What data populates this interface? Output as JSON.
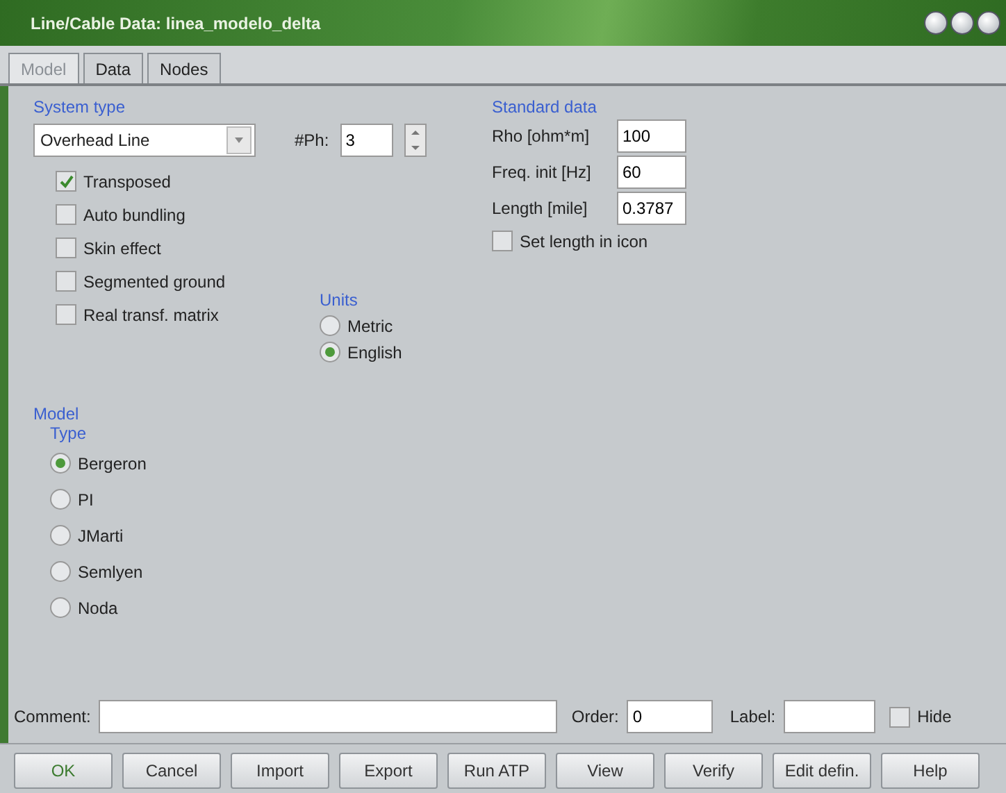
{
  "window": {
    "title": "Line/Cable Data: linea_modelo_delta"
  },
  "tabs": [
    {
      "label": "Model",
      "selected": true
    },
    {
      "label": "Data",
      "selected": false
    },
    {
      "label": "Nodes",
      "selected": false
    }
  ],
  "system_type": {
    "heading": "System type",
    "value": "Overhead Line",
    "phases_label": "#Ph:",
    "phases": "3"
  },
  "options": [
    {
      "label": "Transposed",
      "checked": true
    },
    {
      "label": "Auto bundling",
      "checked": false
    },
    {
      "label": "Skin effect",
      "checked": false
    },
    {
      "label": "Segmented ground",
      "checked": false
    },
    {
      "label": "Real transf. matrix",
      "checked": false
    }
  ],
  "units": {
    "heading": "Units",
    "items": [
      {
        "label": "Metric",
        "selected": false
      },
      {
        "label": "English",
        "selected": true
      }
    ]
  },
  "standard_data": {
    "heading": "Standard data",
    "fields": [
      {
        "label": "Rho [ohm*m]",
        "value": "100"
      },
      {
        "label": "Freq. init [Hz]",
        "value": "60"
      },
      {
        "label": "Length [mile]",
        "value": "0.3787"
      }
    ],
    "set_length": {
      "label": "Set length in icon",
      "checked": false
    }
  },
  "model": {
    "heading": "Model",
    "subheading": "Type",
    "items": [
      {
        "label": "Bergeron",
        "selected": true
      },
      {
        "label": "PI",
        "selected": false
      },
      {
        "label": "JMarti",
        "selected": false
      },
      {
        "label": "Semlyen",
        "selected": false
      },
      {
        "label": "Noda",
        "selected": false
      }
    ]
  },
  "footer": {
    "comment_label": "Comment:",
    "order_label": "Order:",
    "order": "0",
    "label_label": "Label:",
    "hide": {
      "label": "Hide",
      "checked": false
    }
  },
  "buttons": [
    "OK",
    "Cancel",
    "Import",
    "Export",
    "Run ATP",
    "View",
    "Verify",
    "Edit defin.",
    "Help"
  ]
}
